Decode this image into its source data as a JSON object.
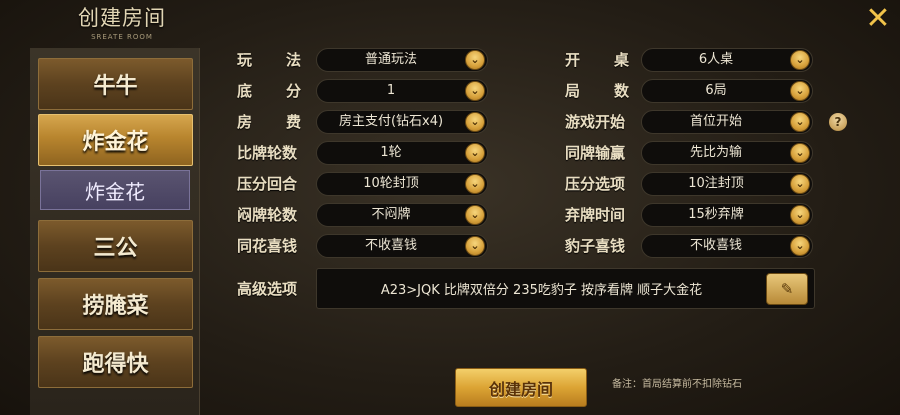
{
  "header": {
    "title": "创建房间",
    "subtitle": "SREATE ROOM",
    "close_icon": "close-icon"
  },
  "sidebar": {
    "items": [
      {
        "label": "牛牛"
      },
      {
        "label": "炸金花"
      },
      {
        "label": "三公"
      },
      {
        "label": "捞腌菜"
      },
      {
        "label": "跑得快"
      }
    ],
    "active_sub": "炸金花"
  },
  "settings": {
    "rows": [
      {
        "left_label": "玩法",
        "left_value": "普通玩法",
        "right_label": "开桌",
        "right_value": "6人桌"
      },
      {
        "left_label": "底分",
        "left_value": "1",
        "right_label": "局数",
        "right_value": "6局"
      },
      {
        "left_label": "房费",
        "left_value": "房主支付(钻石x4)",
        "right_label": "游戏开始",
        "right_value": "首位开始"
      },
      {
        "left_label": "比牌轮数",
        "left_value": "1轮",
        "right_label": "同牌输赢",
        "right_value": "先比为输"
      },
      {
        "left_label": "压分回合",
        "left_value": "10轮封顶",
        "right_label": "压分选项",
        "right_value": "10注封顶"
      },
      {
        "left_label": "闷牌轮数",
        "left_value": "不闷牌",
        "right_label": "弃牌时间",
        "right_value": "15秒弃牌"
      },
      {
        "left_label": "同花喜钱",
        "left_value": "不收喜钱",
        "right_label": "豹子喜钱",
        "right_value": "不收喜钱"
      }
    ],
    "advanced_label": "高级选项",
    "advanced_value": "A23>JQK 比牌双倍分 235吃豹子 按序看牌 顺子大金花"
  },
  "footer": {
    "create_label": "创建房间",
    "note": "备注：首局结算前不扣除钻石"
  },
  "colors": {
    "accent": "#dca434",
    "active_tab": "#b8852e",
    "sub_tab": "#474160"
  }
}
